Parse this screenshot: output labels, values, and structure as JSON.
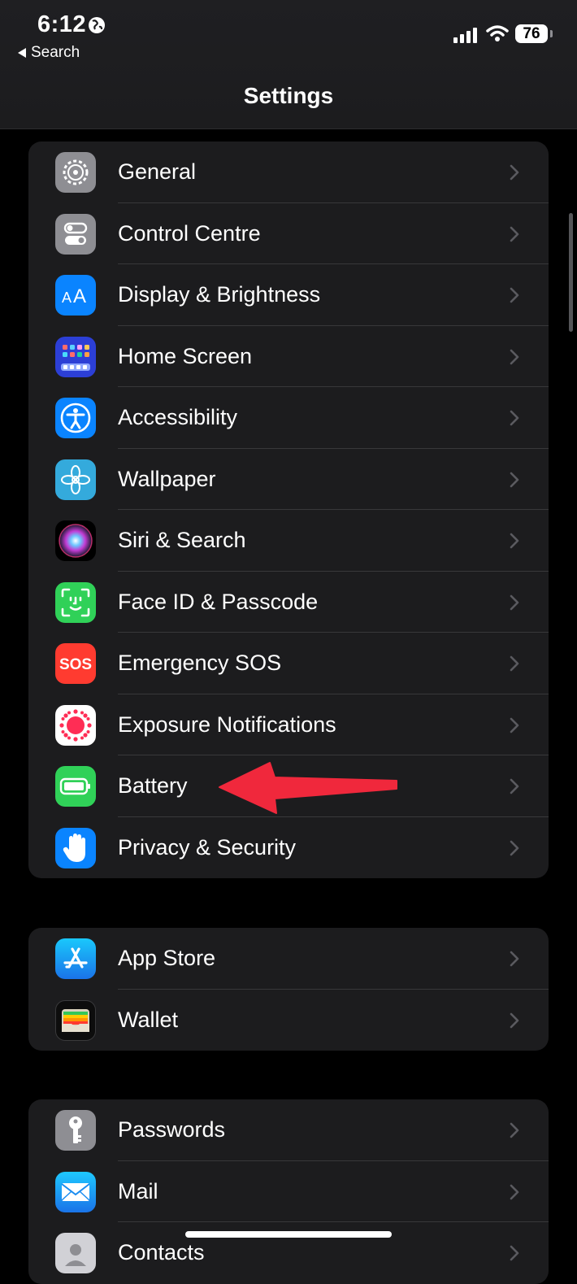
{
  "status_bar": {
    "time": "6:12",
    "back_label": "Search",
    "battery_level": "76"
  },
  "nav": {
    "title": "Settings"
  },
  "groups": [
    {
      "items": [
        {
          "label": "General",
          "icon": "gear-icon",
          "color": "#8e8e93"
        },
        {
          "label": "Control Centre",
          "icon": "toggles-icon",
          "color": "#8e8e93"
        },
        {
          "label": "Display & Brightness",
          "icon": "text-size-icon",
          "color": "#0a84ff"
        },
        {
          "label": "Home Screen",
          "icon": "app-grid-icon",
          "color": "#2c3fd6"
        },
        {
          "label": "Accessibility",
          "icon": "accessibility-icon",
          "color": "#0a84ff"
        },
        {
          "label": "Wallpaper",
          "icon": "flower-icon",
          "color": "#34aadc"
        },
        {
          "label": "Siri & Search",
          "icon": "siri-icon",
          "color": "#1a1a2e"
        },
        {
          "label": "Face ID & Passcode",
          "icon": "face-id-icon",
          "color": "#30d158"
        },
        {
          "label": "Emergency SOS",
          "icon": "sos-icon",
          "color": "#ff3b30"
        },
        {
          "label": "Exposure Notifications",
          "icon": "exposure-icon",
          "color": "#ffffff"
        },
        {
          "label": "Battery",
          "icon": "battery-icon",
          "color": "#30d158"
        },
        {
          "label": "Privacy & Security",
          "icon": "hand-icon",
          "color": "#0a84ff"
        }
      ]
    },
    {
      "items": [
        {
          "label": "App Store",
          "icon": "app-store-icon",
          "color": "#0a84ff"
        },
        {
          "label": "Wallet",
          "icon": "wallet-icon",
          "color": "#1c1c1e"
        }
      ]
    },
    {
      "items": [
        {
          "label": "Passwords",
          "icon": "key-icon",
          "color": "#8e8e93"
        },
        {
          "label": "Mail",
          "icon": "mail-icon",
          "color": "#1e90ff"
        },
        {
          "label": "Contacts",
          "icon": "contacts-icon",
          "color": "#d1d1d6"
        }
      ]
    }
  ],
  "annotation": {
    "color": "#f0283c"
  }
}
